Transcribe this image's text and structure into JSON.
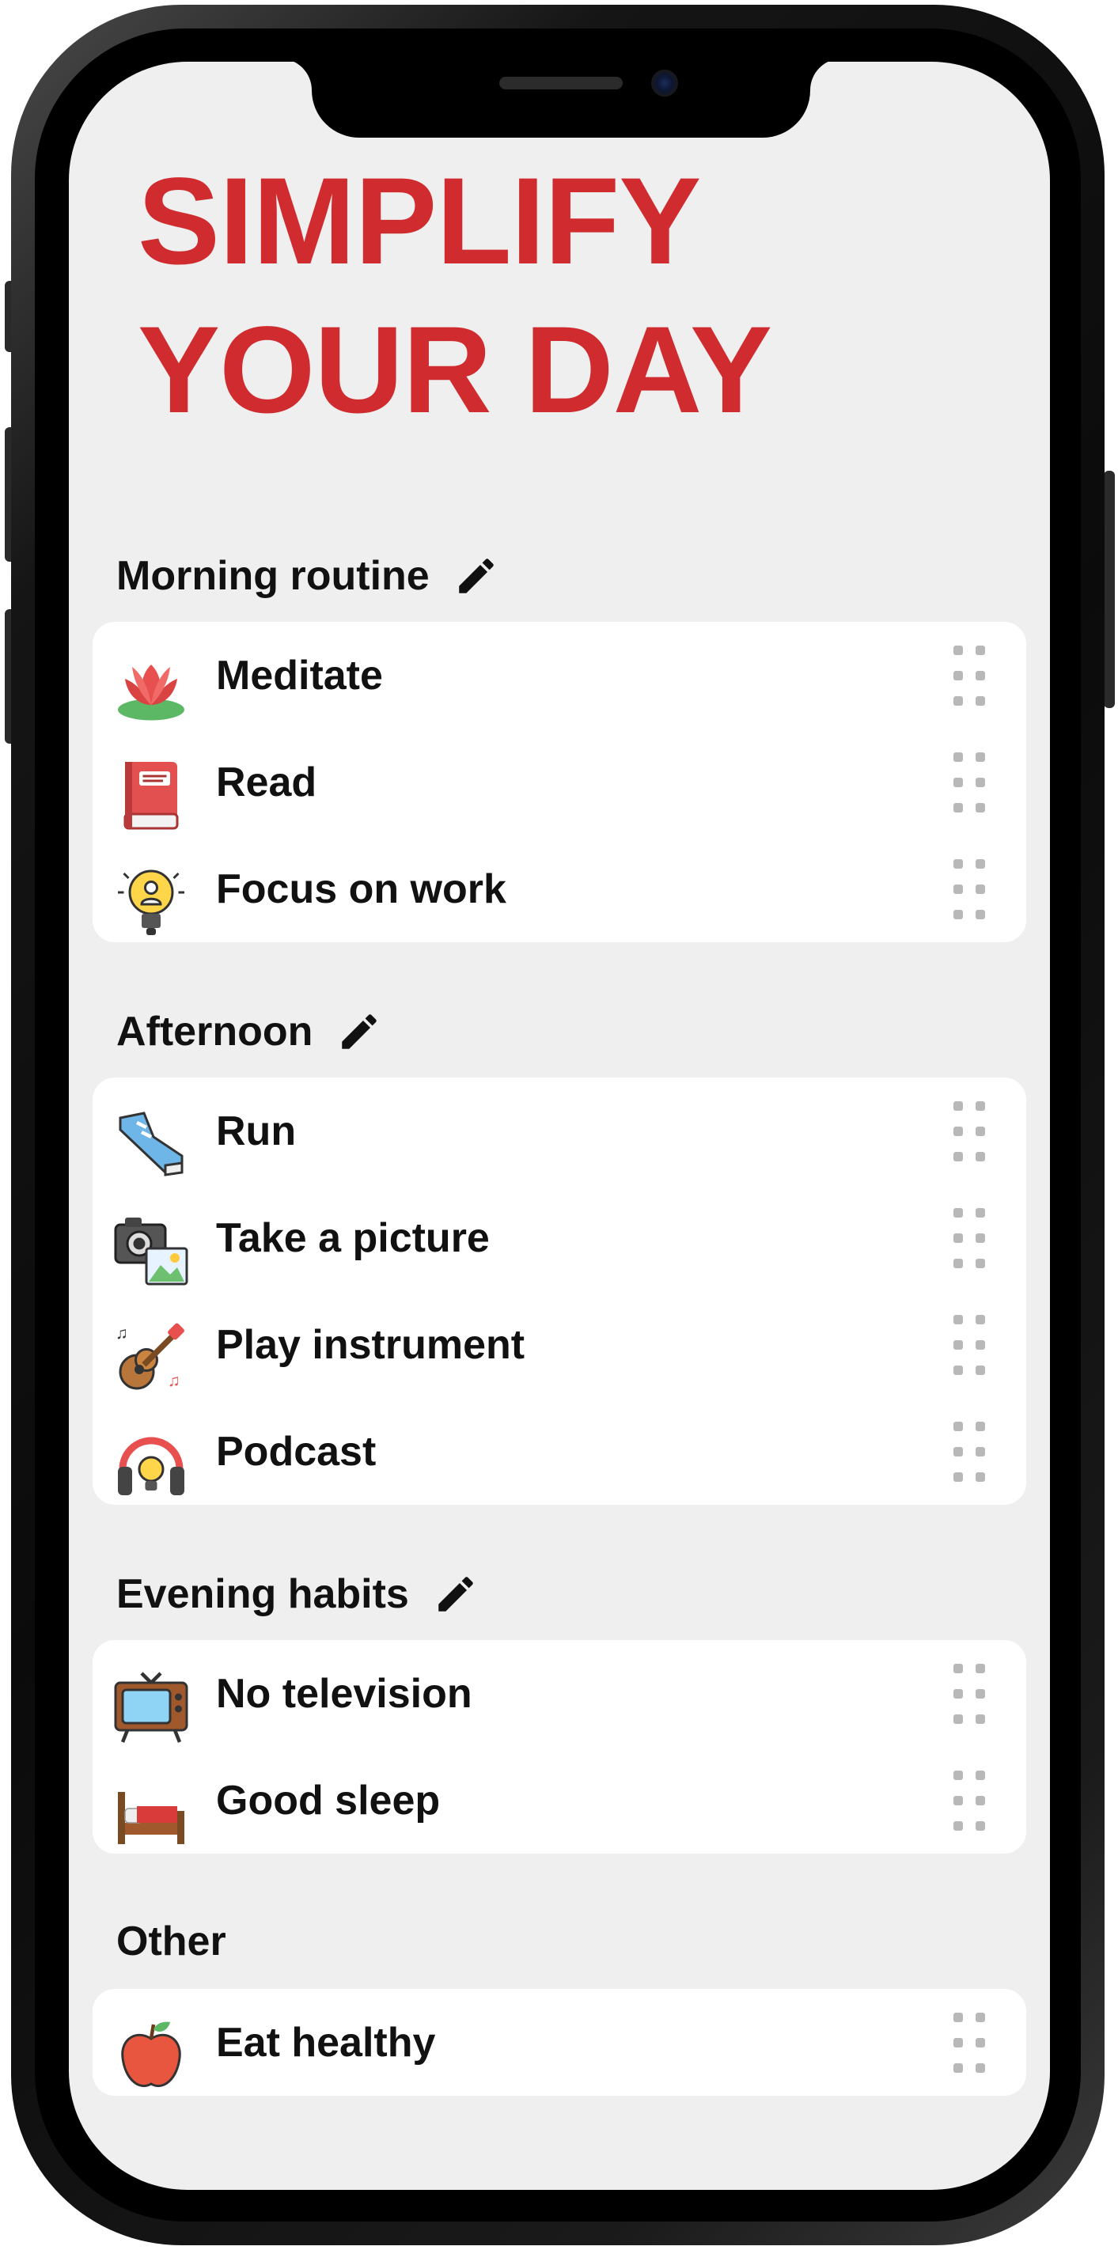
{
  "hero": {
    "line1": "SIMPLIFY",
    "line2": "YOUR DAY"
  },
  "colors": {
    "accent": "#d02b2f",
    "background": "#efefef",
    "card": "#ffffff",
    "handle": "#b8b8b8"
  },
  "sections": [
    {
      "title": "Morning routine",
      "editable": true,
      "items": [
        {
          "label": "Meditate",
          "icon": "lotus-icon"
        },
        {
          "label": "Read",
          "icon": "book-icon"
        },
        {
          "label": "Focus on work",
          "icon": "lightbulb-icon"
        }
      ]
    },
    {
      "title": "Afternoon",
      "editable": true,
      "items": [
        {
          "label": "Run",
          "icon": "running-shoe-icon"
        },
        {
          "label": "Take a picture",
          "icon": "camera-icon"
        },
        {
          "label": "Play instrument",
          "icon": "guitar-icon"
        },
        {
          "label": "Podcast",
          "icon": "headphones-icon"
        }
      ]
    },
    {
      "title": "Evening habits",
      "editable": true,
      "items": [
        {
          "label": "No television",
          "icon": "television-icon"
        },
        {
          "label": "Good sleep",
          "icon": "bed-icon"
        }
      ]
    },
    {
      "title": "Other",
      "editable": false,
      "items": [
        {
          "label": "Eat healthy",
          "icon": "apple-icon"
        }
      ]
    }
  ]
}
